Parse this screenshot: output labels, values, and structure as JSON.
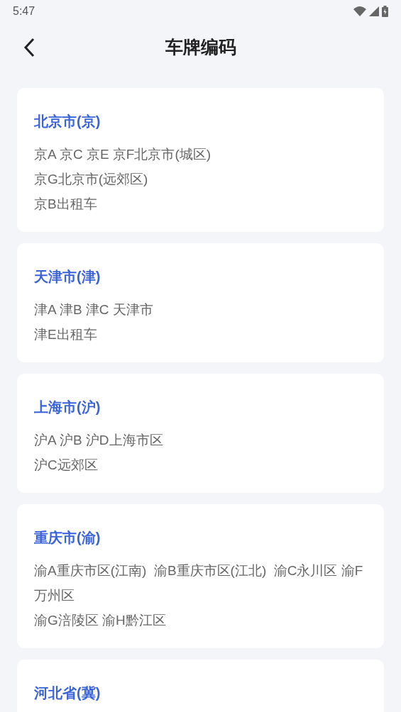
{
  "status_bar": {
    "time": "5:47"
  },
  "header": {
    "title": "车牌编码"
  },
  "cards": [
    {
      "title": "北京市(京)",
      "lines": [
        "京A 京C 京E 京F北京市(城区)",
        "京G北京市(远郊区)",
        "京B出租车"
      ]
    },
    {
      "title": "天津市(津)",
      "lines": [
        "津A 津B 津C 天津市",
        "津E出租车"
      ]
    },
    {
      "title": "上海市(沪)",
      "lines": [
        "沪A 沪B 沪D上海市区",
        "沪C远郊区"
      ]
    },
    {
      "title": "重庆市(渝)",
      "lines": [
        "渝A重庆市区(江南)  渝B重庆市区(江北)  渝C永川区 渝F万州区",
        "渝G涪陵区 渝H黔江区"
      ]
    },
    {
      "title": "河北省(冀)"
    }
  ]
}
